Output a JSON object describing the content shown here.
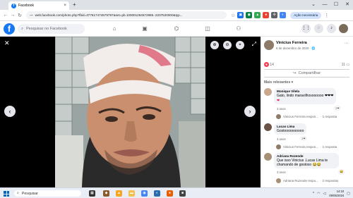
{
  "browser": {
    "tab_title": "Facebook",
    "tab_close": "×",
    "new_tab": "+",
    "window_controls": [
      "⌄",
      "—",
      "☐",
      "✕"
    ],
    "nav": [
      "←",
      "→",
      "↻"
    ],
    "url": "web.facebook.com/photo.php?fbid=377617474579797&set=pb.100001264572985.-2207520000&typ...",
    "paused_label": "Ação necessária"
  },
  "fb": {
    "logo": "f",
    "search_placeholder": "Pesquisar no Facebook"
  },
  "viewer": {
    "close": "✕",
    "prev": "‹",
    "next": "›",
    "fullscreen": "⤢"
  },
  "post": {
    "author": "Vinicius Ferreira",
    "date": "6 de dezembro de 2020 · 🌐",
    "more": "···",
    "reactions_count": "14",
    "comments_count": "11",
    "share_label": "Compartilhar",
    "sort_label": "Mais relevantes ▾"
  },
  "comments": [
    {
      "author": "Monique Vilela",
      "text": "Gato, lindo maravilhosoooooo ❤❤❤",
      "extra": "❤",
      "meta": "3 anos",
      "reaction": "1❤",
      "reply": "Vinicius Ferreira respon...",
      "reply_count": "· 1 resposta"
    },
    {
      "author": "Lucas Lima",
      "text": "Gostoooooooooo",
      "meta": "3 anos",
      "reaction": "1❤",
      "reply": "Vinicius Ferreira respon...",
      "reply_count": "· 1 resposta"
    },
    {
      "author": "Adriana Rozende",
      "text": "Que isso Vinicius .Lucas Lima te chamando de gostoso 😂😂",
      "meta": "3 anos",
      "reaction": "😂",
      "reply": "Adriana Rozende respo...",
      "reply_count": "· 2 respostas"
    }
  ],
  "taskbar": {
    "search_label": "Pesquisar",
    "time": "14:10",
    "date": "09/05/2024"
  },
  "colors": {
    "facebook_blue": "#1877f2",
    "heart": "#f33e58"
  }
}
